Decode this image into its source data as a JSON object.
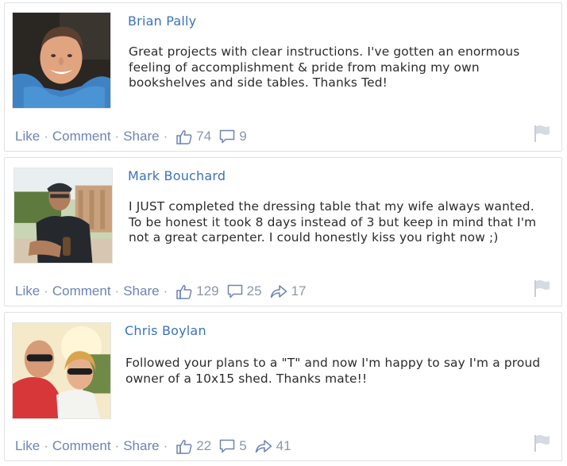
{
  "comments": [
    {
      "name": "Brian Pally",
      "text": "Great projects with clear instructions. I've gotten an enormous feeling of accomplishment & pride from making my own bookshelves and side tables. Thanks Ted!",
      "actions": {
        "like": "Like",
        "comment": "Comment",
        "share": "Share",
        "separator": "·"
      },
      "likes": "74",
      "comments": "9",
      "shares": null,
      "avatar_icon": "person-photo"
    },
    {
      "name": "Mark Bouchard",
      "text": "I JUST completed the dressing table that my wife always wanted. To be honest it took 8 days instead of 3 but keep in mind that I'm not a great carpenter. I could honestly kiss you right now ;)",
      "actions": {
        "like": "Like",
        "comment": "Comment",
        "share": "Share",
        "separator": "·"
      },
      "likes": "129",
      "comments": "25",
      "shares": "17",
      "avatar_icon": "person-photo"
    },
    {
      "name": "Chris Boylan",
      "text": "Followed your plans to a \"T\" and now I'm happy to say I'm a proud owner of a 10x15 shed. Thanks mate!!",
      "actions": {
        "like": "Like",
        "comment": "Comment",
        "share": "Share",
        "separator": "·"
      },
      "likes": "22",
      "comments": "5",
      "shares": "41",
      "avatar_icon": "couple-photo"
    }
  ],
  "colors": {
    "name_link": "#3b73b9",
    "action_link": "#6d84b4",
    "stat_gray": "#8b97aa",
    "border": "#dfe1e6"
  },
  "icons": [
    "thumbs-up-icon",
    "comment-bubble-icon",
    "share-arrow-icon",
    "flag-icon"
  ]
}
